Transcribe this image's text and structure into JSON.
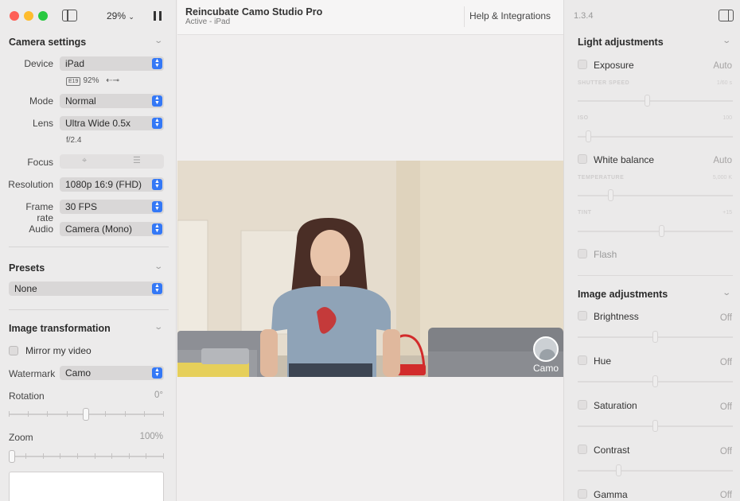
{
  "window": {
    "zoom_label": "29%",
    "app_title": "Reincubate Camo Studio Pro",
    "status": "Active - iPad",
    "help_label": "Help & Integrations",
    "version": "1.3.4",
    "traffic_colors": [
      "#fe5f57",
      "#febc2e",
      "#28c840"
    ]
  },
  "camera_settings": {
    "title": "Camera settings",
    "device_label": "Device",
    "device_value": "iPad",
    "battery_badge": "E19",
    "battery_pct": "92%",
    "usb_icon": "⇠⊸",
    "mode_label": "Mode",
    "mode_value": "Normal",
    "lens_label": "Lens",
    "lens_value": "Ultra Wide 0.5x",
    "aperture": "f/2.4",
    "focus_label": "Focus",
    "resolution_label": "Resolution",
    "resolution_value": "1080p 16:9 (FHD)",
    "framerate_label": "Frame rate",
    "framerate_value": "30 FPS",
    "audio_label": "Audio",
    "audio_value": "Camera (Mono)"
  },
  "presets": {
    "title": "Presets",
    "value": "None"
  },
  "image_transformation": {
    "title": "Image transformation",
    "mirror_label": "Mirror my video",
    "watermark_label": "Watermark",
    "watermark_value": "Camo",
    "rotation_label": "Rotation",
    "rotation_value": "0°",
    "zoom_label": "Zoom",
    "zoom_value": "100%"
  },
  "video": {
    "badge_label": "Camo"
  },
  "light_adjustments": {
    "title": "Light adjustments",
    "exposure_label": "Exposure",
    "exposure_value": "Auto",
    "shutter_caption": "SHUTTER SPEED",
    "shutter_value": "1/60 s",
    "iso_caption": "ISO",
    "iso_value": "100",
    "white_balance_label": "White balance",
    "white_balance_value": "Auto",
    "temperature_caption": "TEMPERATURE",
    "temperature_value": "5,000 K",
    "tint_caption": "TINT",
    "tint_value": "+15",
    "flash_label": "Flash"
  },
  "image_adjustments": {
    "title": "Image adjustments",
    "brightness_label": "Brightness",
    "brightness_value": "Off",
    "hue_label": "Hue",
    "hue_value": "Off",
    "saturation_label": "Saturation",
    "saturation_value": "Off",
    "contrast_label": "Contrast",
    "contrast_value": "Off",
    "gamma_label": "Gamma",
    "gamma_value": "Off"
  }
}
